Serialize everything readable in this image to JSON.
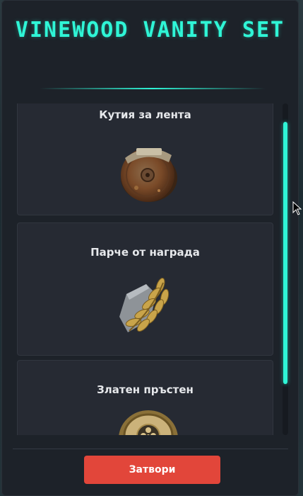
{
  "modal": {
    "title": "VINEWOOD VANITY SET",
    "accent_color": "#2ff5d6"
  },
  "items": [
    {
      "name": "Кутия за лента",
      "icon": "film-canister-icon"
    },
    {
      "name": "Парче от награда",
      "icon": "laurel-fragment-icon"
    },
    {
      "name": "Златен пръстен",
      "icon": "gold-ring-icon"
    }
  ],
  "footer": {
    "close_label": "Затвори",
    "close_color": "#e2463a"
  }
}
